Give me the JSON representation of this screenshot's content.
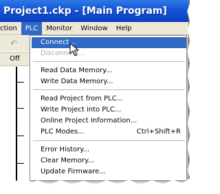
{
  "window": {
    "title": "Project1.ckp - [Main Program]"
  },
  "menubar": {
    "items": [
      {
        "label": "ction"
      },
      {
        "label": "PLC",
        "active": true
      },
      {
        "label": "Monitor"
      },
      {
        "label": "Window"
      },
      {
        "label": "Help"
      }
    ]
  },
  "toolbar": {
    "off_label": "Off",
    "undo_icon": "undo-icon"
  },
  "plc_menu": {
    "items": [
      {
        "label": "Connect...",
        "state": "highlighted"
      },
      {
        "label": "Disconnect...",
        "state": "disabled"
      },
      {
        "label": "Read Data Memory..."
      },
      {
        "label": "Write Data Memory..."
      },
      {
        "label": "Read Project from PLC..."
      },
      {
        "label": "Write Project into PLC..."
      },
      {
        "label": "Online Project Information..."
      },
      {
        "label": "PLC Modes...",
        "shortcut": "Ctrl+Shift+R"
      },
      {
        "label": "Error History..."
      },
      {
        "label": "Clear Memory..."
      },
      {
        "label": "Update Firmware..."
      }
    ]
  },
  "colors": {
    "titlebar": "#1654d6",
    "highlight": "#316ac5",
    "menubar": "#ece9d8"
  }
}
